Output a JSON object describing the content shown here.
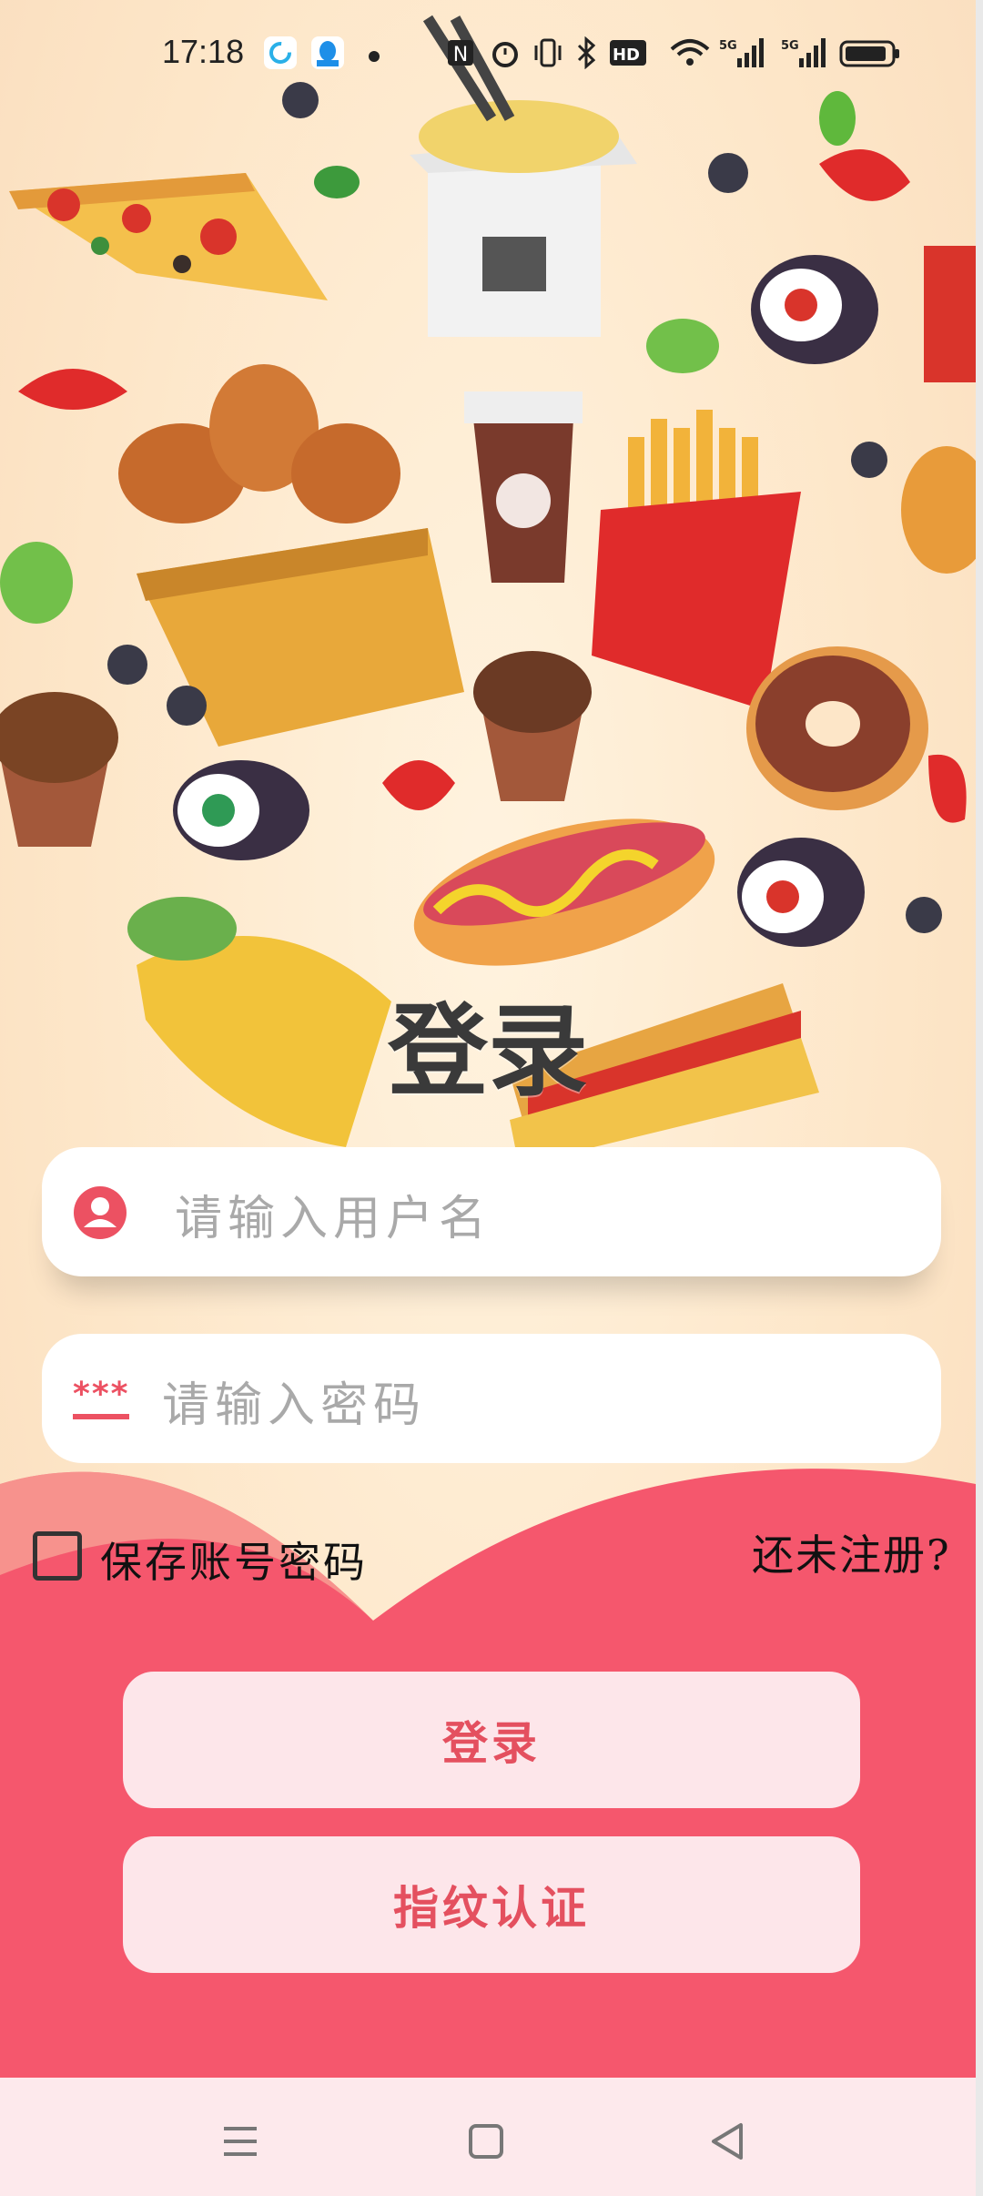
{
  "status_bar": {
    "time": "17:18",
    "icons": [
      "sync-icon",
      "qq-icon",
      "dot-icon",
      "nfc-icon",
      "alarm-icon",
      "vibrate-icon",
      "bluetooth-icon",
      "hd-icon",
      "wifi-icon",
      "signal-5g-icon",
      "signal-5g-icon",
      "battery-icon"
    ],
    "hd_label": "HD",
    "net_label_1": "5G",
    "net_label_2": "5G"
  },
  "login": {
    "title": "登录",
    "username_placeholder": "请输入用户名",
    "password_placeholder": "请输入密码",
    "password_icon_text": "***",
    "remember_label": "保存账号密码",
    "register_link": "还未注册?",
    "login_button": "登录",
    "fingerprint_button": "指纹认证"
  },
  "nav_bar": {
    "icons": [
      "menu-icon",
      "home-square-icon",
      "back-triangle-icon"
    ]
  },
  "colors": {
    "accent": "#f5576d",
    "button_bg": "#fde6ea",
    "button_text": "#e4505f",
    "background": "#fde6c8"
  }
}
